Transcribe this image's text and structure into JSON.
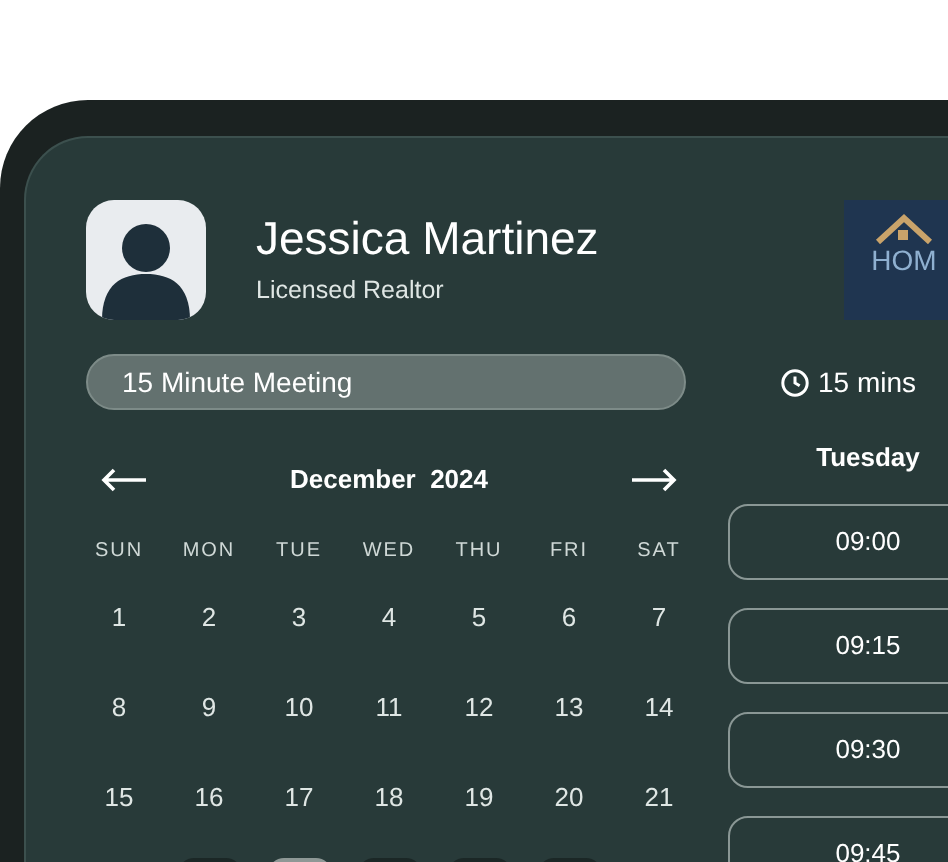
{
  "profile": {
    "name": "Jessica Martinez",
    "role": "Licensed Realtor",
    "logo_text": "HOM"
  },
  "meeting": {
    "title": "15 Minute Meeting",
    "duration": "15 mins"
  },
  "calendar": {
    "month": "December  2024",
    "weekdays": [
      "SUN",
      "MON",
      "TUE",
      "WED",
      "THU",
      "FRI",
      "SAT"
    ],
    "weeks": [
      [
        "1",
        "2",
        "3",
        "4",
        "5",
        "6",
        "7"
      ],
      [
        "8",
        "9",
        "10",
        "11",
        "12",
        "13",
        "14"
      ],
      [
        "15",
        "16",
        "17",
        "18",
        "19",
        "20",
        "21"
      ]
    ],
    "partial_week": [
      {
        "available": false
      },
      {
        "available": true,
        "selected": false
      },
      {
        "available": true,
        "selected": true
      },
      {
        "available": true,
        "selected": false
      },
      {
        "available": true,
        "selected": false
      },
      {
        "available": true,
        "selected": false
      },
      {
        "available": false
      }
    ]
  },
  "slots": {
    "day": "Tuesday",
    "times": [
      "09:00",
      "09:15",
      "09:30",
      "09:45"
    ]
  }
}
